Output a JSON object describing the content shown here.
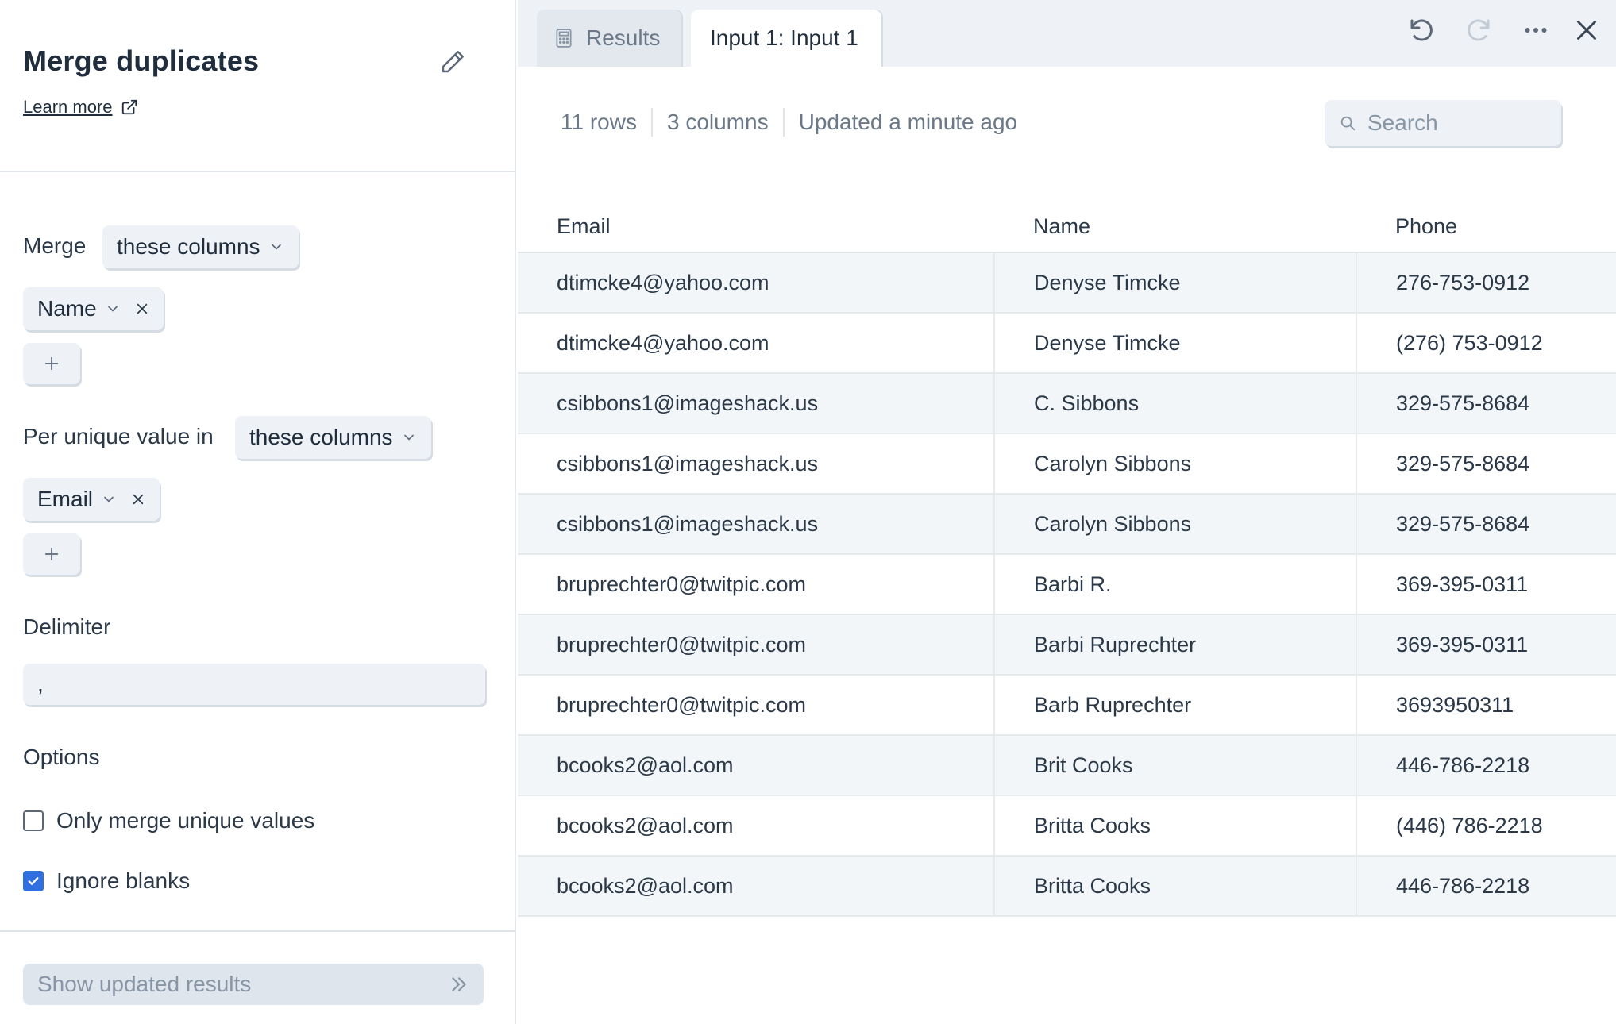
{
  "panel": {
    "title": "Merge duplicates",
    "learn_more": "Learn more",
    "merge_label": "Merge",
    "merge_mode": "these columns",
    "merge_columns": [
      "Name"
    ],
    "per_unique_label": "Per unique value in",
    "per_unique_mode": "these columns",
    "per_unique_columns": [
      "Email"
    ],
    "add_symbol": "+",
    "delimiter_label": "Delimiter",
    "delimiter_value": ",",
    "options_label": "Options",
    "options": [
      {
        "label": "Only merge unique values",
        "checked": false
      },
      {
        "label": "Ignore blanks",
        "checked": true
      }
    ],
    "show_results": "Show updated results"
  },
  "tabs": [
    {
      "label": "Results",
      "active": false
    },
    {
      "label": "Input 1: Input 1",
      "active": true
    }
  ],
  "stats": {
    "rows": "11 rows",
    "columns": "3 columns",
    "updated": "Updated a minute ago"
  },
  "search": {
    "placeholder": "Search"
  },
  "table": {
    "headers": [
      "Email",
      "Name",
      "Phone"
    ],
    "rows": [
      [
        "dtimcke4@yahoo.com",
        "Denyse Timcke",
        "276-753-0912"
      ],
      [
        "dtimcke4@yahoo.com",
        "Denyse Timcke",
        "(276) 753-0912"
      ],
      [
        "csibbons1@imageshack.us",
        "C. Sibbons",
        "329-575-8684"
      ],
      [
        "csibbons1@imageshack.us",
        "Carolyn Sibbons",
        "329-575-8684"
      ],
      [
        "csibbons1@imageshack.us",
        "Carolyn Sibbons",
        "329-575-8684"
      ],
      [
        "bruprechter0@twitpic.com",
        "Barbi R.",
        "369-395-0311"
      ],
      [
        "bruprechter0@twitpic.com",
        "Barbi Ruprechter",
        "369-395-0311"
      ],
      [
        "bruprechter0@twitpic.com",
        "Barb Ruprechter",
        "3693950311"
      ],
      [
        "bcooks2@aol.com",
        "Brit Cooks",
        "446-786-2218"
      ],
      [
        "bcooks2@aol.com",
        "Britta Cooks",
        "(446) 786-2218"
      ],
      [
        "bcooks2@aol.com",
        "Britta Cooks",
        "446-786-2218"
      ]
    ]
  },
  "colors": {
    "accent": "#2f6fe0",
    "text": "#1f2d3d",
    "muted": "#6b7888",
    "control_bg": "#eef2f6",
    "row_stripe": "#f3f6f9"
  }
}
